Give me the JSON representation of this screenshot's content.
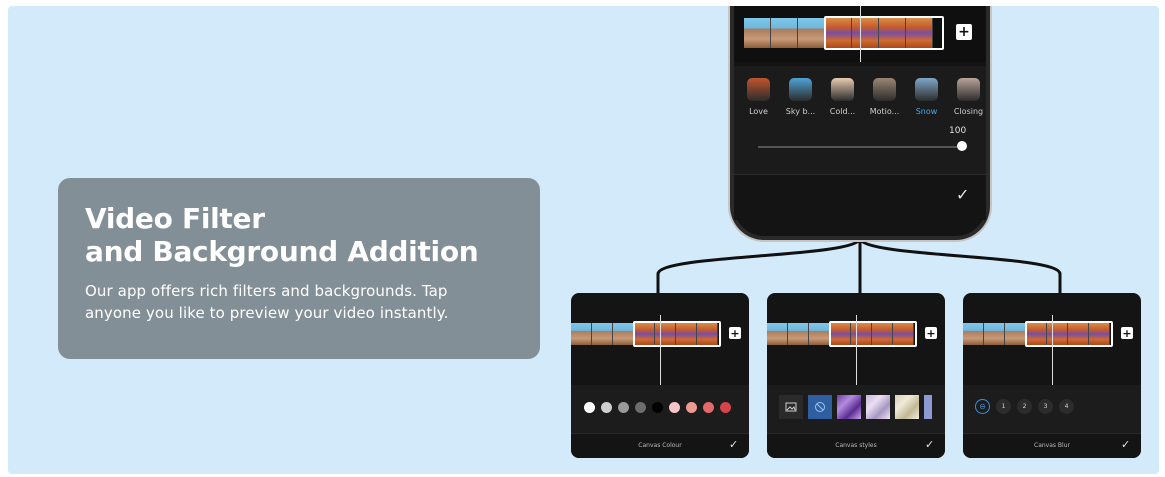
{
  "info_card": {
    "title_line1": "Video Filter",
    "title_line2": "and Background Addition",
    "desc_line1": "Our app offers rich filters and backgrounds. Tap",
    "desc_line2": "anyone you like to preview your video instantly."
  },
  "colors": {
    "banner_bg": "#d3eafb",
    "card_bg": "#838f96",
    "phone_bg": "#141414",
    "accent_blue": "#4ba6ea"
  },
  "main_phone": {
    "add_clip_icon": "plus-icon",
    "filters": [
      {
        "label": "Love",
        "icon": "love-thumb",
        "color": "#c0552f"
      },
      {
        "label": "Sky b...",
        "icon": "sky-thumb",
        "color": "#4fa3d4"
      },
      {
        "label": "Cold...",
        "icon": "cold-thumb",
        "color": "#e7cbb0"
      },
      {
        "label": "Motio...",
        "icon": "motion-thumb",
        "color": "#9a8574"
      },
      {
        "label": "Snow",
        "icon": "snow-thumb",
        "color": "#7fa8c8",
        "active": true
      },
      {
        "label": "Closing",
        "icon": "closing-thumb",
        "color": "#b8a49a"
      }
    ],
    "intensity_value": "100",
    "intensity_fraction": 1.0,
    "confirm_icon": "check-icon"
  },
  "mini_phones": [
    {
      "id": "canvas-colour",
      "footer_label": "Canvas Colour",
      "colors": [
        "#ffffff",
        "#cfcfcf",
        "#9a9a9a",
        "#6d6d6d",
        "#000000",
        "#f6c5c5",
        "#ee9a8f",
        "#e26a6a",
        "#d9424a"
      ]
    },
    {
      "id": "canvas-styles",
      "footer_label": "Canvas styles",
      "styles": [
        "image-picker-icon",
        "none-icon",
        "purple-marble",
        "lilac-marble",
        "beige-marble"
      ]
    },
    {
      "id": "canvas-blur",
      "footer_label": "Canvas Blur",
      "options": [
        "1",
        "2",
        "3",
        "4"
      ],
      "none_icon": "no-blur-icon"
    }
  ]
}
